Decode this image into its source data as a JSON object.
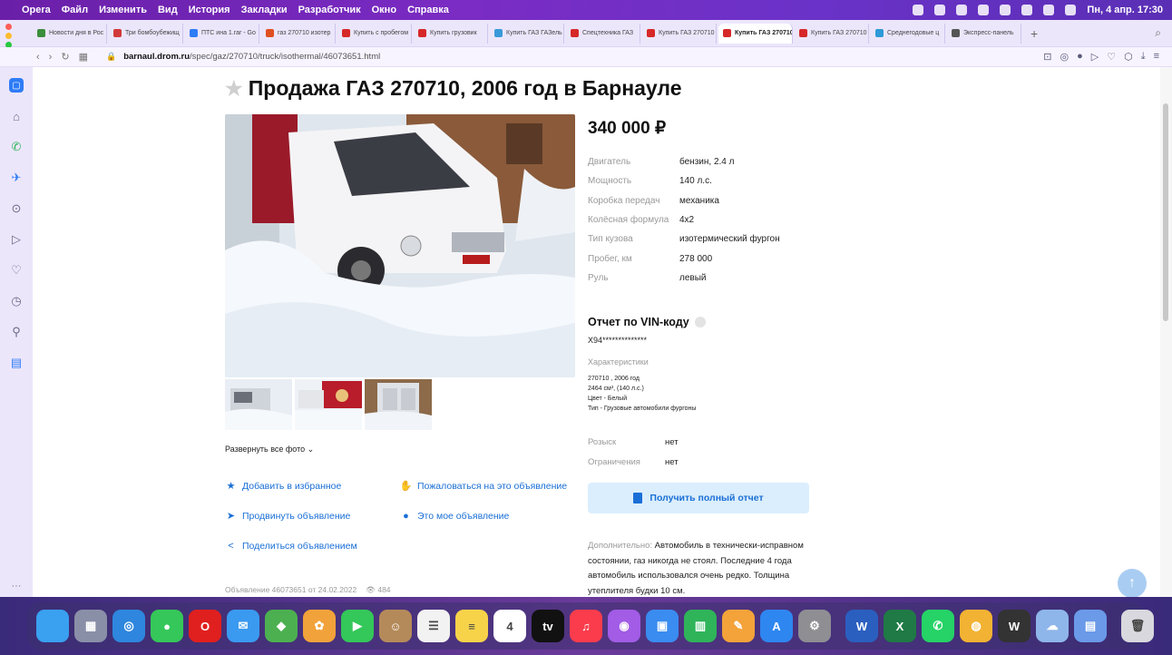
{
  "menubar": {
    "items": [
      "Opera",
      "Файл",
      "Изменить",
      "Вид",
      "История",
      "Закладки",
      "Разработчик",
      "Окно",
      "Справка"
    ],
    "clock": "Пн, 4 апр. 17:30"
  },
  "tabs": [
    {
      "label": "Новости дня в Рос",
      "color": "#3c8d3c"
    },
    {
      "label": "Три бомбоубежищ",
      "color": "#d23a3a"
    },
    {
      "label": "ПТС ина 1.rar - Go",
      "color": "#2e7cf6"
    },
    {
      "label": "газ 270710 изотер",
      "color": "#e05020"
    },
    {
      "label": "Купить с пробегом",
      "color": "#d62828"
    },
    {
      "label": "Купить грузовик",
      "color": "#d62828"
    },
    {
      "label": "Купить ГАЗ ГАЗель",
      "color": "#3a9ad9"
    },
    {
      "label": "Спецтехника ГАЗ",
      "color": "#d62828"
    },
    {
      "label": "Купить ГАЗ 270710",
      "color": "#d62828"
    },
    {
      "label": "Купить ГАЗ 270710",
      "color": "#d62828",
      "active": true
    },
    {
      "label": "Купить ГАЗ 270710",
      "color": "#d62828"
    },
    {
      "label": "Среднегодовые ц",
      "color": "#2e9ad6"
    },
    {
      "label": "Экспресс-панель",
      "color": "#555"
    }
  ],
  "address": {
    "domain": "barnaul.drom.ru",
    "path": "/spec/gaz/270710/truck/isothermal/46073651.html"
  },
  "listing": {
    "title": "Продажа ГАЗ 270710, 2006 год в Барнауле",
    "price": "340 000 ₽",
    "specs": [
      {
        "k": "Двигатель",
        "v": "бензин, 2.4 л"
      },
      {
        "k": "Мощность",
        "v": "140 л.с."
      },
      {
        "k": "Коробка передач",
        "v": "механика"
      },
      {
        "k": "Колёсная формула",
        "v": "4x2"
      },
      {
        "k": "Тип кузова",
        "v": "изотермический фургон"
      },
      {
        "k": "Пробег, км",
        "v": "278 000"
      },
      {
        "k": "Руль",
        "v": "левый"
      }
    ],
    "expand_photos": "Развернуть все фото ⌄",
    "actions": {
      "favorite": "Добавить в избранное",
      "complain": "Пожаловаться на это объявление",
      "promote": "Продвинуть объявление",
      "mine": "Это мое объявление",
      "share": "Поделиться объявлением"
    },
    "meta": {
      "listing_id": "Объявление 46073651 от 24.02.2022",
      "views": "484"
    },
    "vin": {
      "title": "Отчет по VIN-коду",
      "code": "X94**************",
      "char_label": "Характеристики",
      "char_lines": [
        "270710 , 2006 год",
        "2464 см³, (140 л.с.)",
        "Цвет - Белый",
        "Тип - Грузовые автомобили фургоны"
      ],
      "wanted_label": "Розыск",
      "wanted_value": "нет",
      "restrictions_label": "Ограничения",
      "restrictions_value": "нет",
      "button": "Получить полный отчет"
    },
    "extra": {
      "label": "Дополнительно:",
      "text": "Автомобиль в технически-исправном состоянии, газ никогда не стоял. Последние 4 года автомобиль использовался очень редко. Толщина утеплителя будки 10 см."
    }
  },
  "dock": {
    "icons": [
      {
        "name": "finder",
        "color": "#3aa0f0",
        "glyph": ""
      },
      {
        "name": "launchpad",
        "color": "#8a8fa8",
        "glyph": "▦"
      },
      {
        "name": "safari",
        "color": "#2e86de",
        "glyph": "◎"
      },
      {
        "name": "messages",
        "color": "#35c759",
        "glyph": "●"
      },
      {
        "name": "opera",
        "color": "#e0201e",
        "glyph": "O"
      },
      {
        "name": "mail",
        "color": "#3a9af0",
        "glyph": "✉"
      },
      {
        "name": "maps",
        "color": "#4cb050",
        "glyph": "◆"
      },
      {
        "name": "photos",
        "color": "#f2a23a",
        "glyph": "✿"
      },
      {
        "name": "facetime",
        "color": "#34c759",
        "glyph": "▶"
      },
      {
        "name": "contacts",
        "color": "#b58a5a",
        "glyph": "☺"
      },
      {
        "name": "reminders",
        "color": "#f2f2f2",
        "glyph": "☰"
      },
      {
        "name": "notes",
        "color": "#f7d34a",
        "glyph": "≡"
      },
      {
        "name": "calendar",
        "color": "#ffffff",
        "glyph": "4"
      },
      {
        "name": "tv",
        "color": "#111111",
        "glyph": "tv"
      },
      {
        "name": "music",
        "color": "#fa3c4c",
        "glyph": "♫"
      },
      {
        "name": "podcasts",
        "color": "#a25ce6",
        "glyph": "◉"
      },
      {
        "name": "keynote",
        "color": "#3a8cf0",
        "glyph": "▣"
      },
      {
        "name": "numbers",
        "color": "#2fb45a",
        "glyph": "▥"
      },
      {
        "name": "pages",
        "color": "#f3a33a",
        "glyph": "✎"
      },
      {
        "name": "app-store",
        "color": "#2e86f0",
        "glyph": "A"
      },
      {
        "name": "settings",
        "color": "#8e8e93",
        "glyph": "⚙"
      },
      {
        "name": "word",
        "color": "#2b5fbf",
        "glyph": "W"
      },
      {
        "name": "excel",
        "color": "#1f7a45",
        "glyph": "X"
      },
      {
        "name": "whatsapp",
        "color": "#25d366",
        "glyph": "✆"
      },
      {
        "name": "chrome",
        "color": "#f2b233",
        "glyph": "◍"
      },
      {
        "name": "wps",
        "color": "#333333",
        "glyph": "W"
      },
      {
        "name": "cloud-app",
        "color": "#8fb6ea",
        "glyph": "☁"
      },
      {
        "name": "preview",
        "color": "#6a9ae8",
        "glyph": "▤"
      },
      {
        "name": "trash",
        "color": "#d8d8de",
        "glyph": "🗑"
      }
    ]
  }
}
